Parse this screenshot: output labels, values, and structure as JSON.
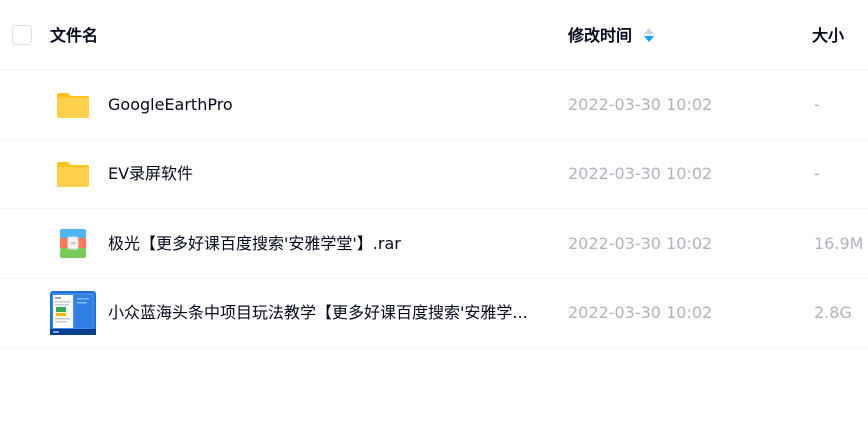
{
  "header": {
    "select_all": "",
    "name_label": "文件名",
    "time_label": "修改时间",
    "size_label": "大小",
    "sort_icon": "sort-desc-icon"
  },
  "colors": {
    "folder": "#FFD04C",
    "folder_tab": "#FFC21C",
    "sort_active": "#06A7FF",
    "text_primary": "#03081A",
    "text_secondary": "#AFB3BF"
  },
  "files": [
    {
      "name": "GoogleEarthPro",
      "time": "2022-03-30 10:02",
      "size": "-",
      "icon": "folder-icon"
    },
    {
      "name": "EV录屏软件",
      "time": "2022-03-30 10:02",
      "size": "-",
      "icon": "folder-icon"
    },
    {
      "name": "极光【更多好课百度搜索'安雅学堂'】.rar",
      "time": "2022-03-30 10:02",
      "size": "16.9M",
      "icon": "archive-icon"
    },
    {
      "name": "小众蓝海头条中项目玩法教学【更多好课百度搜索'安雅学...",
      "time": "2022-03-30 10:02",
      "size": "2.8G",
      "icon": "video-thumbnail-icon"
    }
  ]
}
